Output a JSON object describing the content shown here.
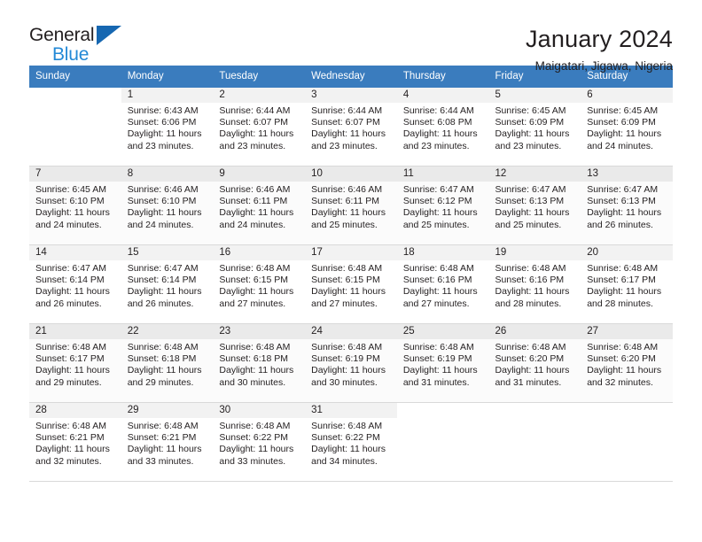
{
  "brand": {
    "word_general": "General",
    "word_blue": "Blue",
    "triangle_icon": "triangle-icon"
  },
  "header": {
    "title": "January 2024",
    "subtitle": "Maigatari, Jigawa, Nigeria"
  },
  "calendar": {
    "weekday_headers": [
      "Sunday",
      "Monday",
      "Tuesday",
      "Wednesday",
      "Thursday",
      "Friday",
      "Saturday"
    ],
    "accent_color": "#3a7cbe",
    "weeks": [
      [
        {
          "day": ""
        },
        {
          "day": "1",
          "sunrise": "Sunrise: 6:43 AM",
          "sunset": "Sunset: 6:06 PM",
          "daylight": "Daylight: 11 hours and 23 minutes."
        },
        {
          "day": "2",
          "sunrise": "Sunrise: 6:44 AM",
          "sunset": "Sunset: 6:07 PM",
          "daylight": "Daylight: 11 hours and 23 minutes."
        },
        {
          "day": "3",
          "sunrise": "Sunrise: 6:44 AM",
          "sunset": "Sunset: 6:07 PM",
          "daylight": "Daylight: 11 hours and 23 minutes."
        },
        {
          "day": "4",
          "sunrise": "Sunrise: 6:44 AM",
          "sunset": "Sunset: 6:08 PM",
          "daylight": "Daylight: 11 hours and 23 minutes."
        },
        {
          "day": "5",
          "sunrise": "Sunrise: 6:45 AM",
          "sunset": "Sunset: 6:09 PM",
          "daylight": "Daylight: 11 hours and 23 minutes."
        },
        {
          "day": "6",
          "sunrise": "Sunrise: 6:45 AM",
          "sunset": "Sunset: 6:09 PM",
          "daylight": "Daylight: 11 hours and 24 minutes."
        }
      ],
      [
        {
          "day": "7",
          "sunrise": "Sunrise: 6:45 AM",
          "sunset": "Sunset: 6:10 PM",
          "daylight": "Daylight: 11 hours and 24 minutes."
        },
        {
          "day": "8",
          "sunrise": "Sunrise: 6:46 AM",
          "sunset": "Sunset: 6:10 PM",
          "daylight": "Daylight: 11 hours and 24 minutes."
        },
        {
          "day": "9",
          "sunrise": "Sunrise: 6:46 AM",
          "sunset": "Sunset: 6:11 PM",
          "daylight": "Daylight: 11 hours and 24 minutes."
        },
        {
          "day": "10",
          "sunrise": "Sunrise: 6:46 AM",
          "sunset": "Sunset: 6:11 PM",
          "daylight": "Daylight: 11 hours and 25 minutes."
        },
        {
          "day": "11",
          "sunrise": "Sunrise: 6:47 AM",
          "sunset": "Sunset: 6:12 PM",
          "daylight": "Daylight: 11 hours and 25 minutes."
        },
        {
          "day": "12",
          "sunrise": "Sunrise: 6:47 AM",
          "sunset": "Sunset: 6:13 PM",
          "daylight": "Daylight: 11 hours and 25 minutes."
        },
        {
          "day": "13",
          "sunrise": "Sunrise: 6:47 AM",
          "sunset": "Sunset: 6:13 PM",
          "daylight": "Daylight: 11 hours and 26 minutes."
        }
      ],
      [
        {
          "day": "14",
          "sunrise": "Sunrise: 6:47 AM",
          "sunset": "Sunset: 6:14 PM",
          "daylight": "Daylight: 11 hours and 26 minutes."
        },
        {
          "day": "15",
          "sunrise": "Sunrise: 6:47 AM",
          "sunset": "Sunset: 6:14 PM",
          "daylight": "Daylight: 11 hours and 26 minutes."
        },
        {
          "day": "16",
          "sunrise": "Sunrise: 6:48 AM",
          "sunset": "Sunset: 6:15 PM",
          "daylight": "Daylight: 11 hours and 27 minutes."
        },
        {
          "day": "17",
          "sunrise": "Sunrise: 6:48 AM",
          "sunset": "Sunset: 6:15 PM",
          "daylight": "Daylight: 11 hours and 27 minutes."
        },
        {
          "day": "18",
          "sunrise": "Sunrise: 6:48 AM",
          "sunset": "Sunset: 6:16 PM",
          "daylight": "Daylight: 11 hours and 27 minutes."
        },
        {
          "day": "19",
          "sunrise": "Sunrise: 6:48 AM",
          "sunset": "Sunset: 6:16 PM",
          "daylight": "Daylight: 11 hours and 28 minutes."
        },
        {
          "day": "20",
          "sunrise": "Sunrise: 6:48 AM",
          "sunset": "Sunset: 6:17 PM",
          "daylight": "Daylight: 11 hours and 28 minutes."
        }
      ],
      [
        {
          "day": "21",
          "sunrise": "Sunrise: 6:48 AM",
          "sunset": "Sunset: 6:17 PM",
          "daylight": "Daylight: 11 hours and 29 minutes."
        },
        {
          "day": "22",
          "sunrise": "Sunrise: 6:48 AM",
          "sunset": "Sunset: 6:18 PM",
          "daylight": "Daylight: 11 hours and 29 minutes."
        },
        {
          "day": "23",
          "sunrise": "Sunrise: 6:48 AM",
          "sunset": "Sunset: 6:18 PM",
          "daylight": "Daylight: 11 hours and 30 minutes."
        },
        {
          "day": "24",
          "sunrise": "Sunrise: 6:48 AM",
          "sunset": "Sunset: 6:19 PM",
          "daylight": "Daylight: 11 hours and 30 minutes."
        },
        {
          "day": "25",
          "sunrise": "Sunrise: 6:48 AM",
          "sunset": "Sunset: 6:19 PM",
          "daylight": "Daylight: 11 hours and 31 minutes."
        },
        {
          "day": "26",
          "sunrise": "Sunrise: 6:48 AM",
          "sunset": "Sunset: 6:20 PM",
          "daylight": "Daylight: 11 hours and 31 minutes."
        },
        {
          "day": "27",
          "sunrise": "Sunrise: 6:48 AM",
          "sunset": "Sunset: 6:20 PM",
          "daylight": "Daylight: 11 hours and 32 minutes."
        }
      ],
      [
        {
          "day": "28",
          "sunrise": "Sunrise: 6:48 AM",
          "sunset": "Sunset: 6:21 PM",
          "daylight": "Daylight: 11 hours and 32 minutes."
        },
        {
          "day": "29",
          "sunrise": "Sunrise: 6:48 AM",
          "sunset": "Sunset: 6:21 PM",
          "daylight": "Daylight: 11 hours and 33 minutes."
        },
        {
          "day": "30",
          "sunrise": "Sunrise: 6:48 AM",
          "sunset": "Sunset: 6:22 PM",
          "daylight": "Daylight: 11 hours and 33 minutes."
        },
        {
          "day": "31",
          "sunrise": "Sunrise: 6:48 AM",
          "sunset": "Sunset: 6:22 PM",
          "daylight": "Daylight: 11 hours and 34 minutes."
        },
        {
          "day": ""
        },
        {
          "day": ""
        },
        {
          "day": ""
        }
      ]
    ]
  }
}
